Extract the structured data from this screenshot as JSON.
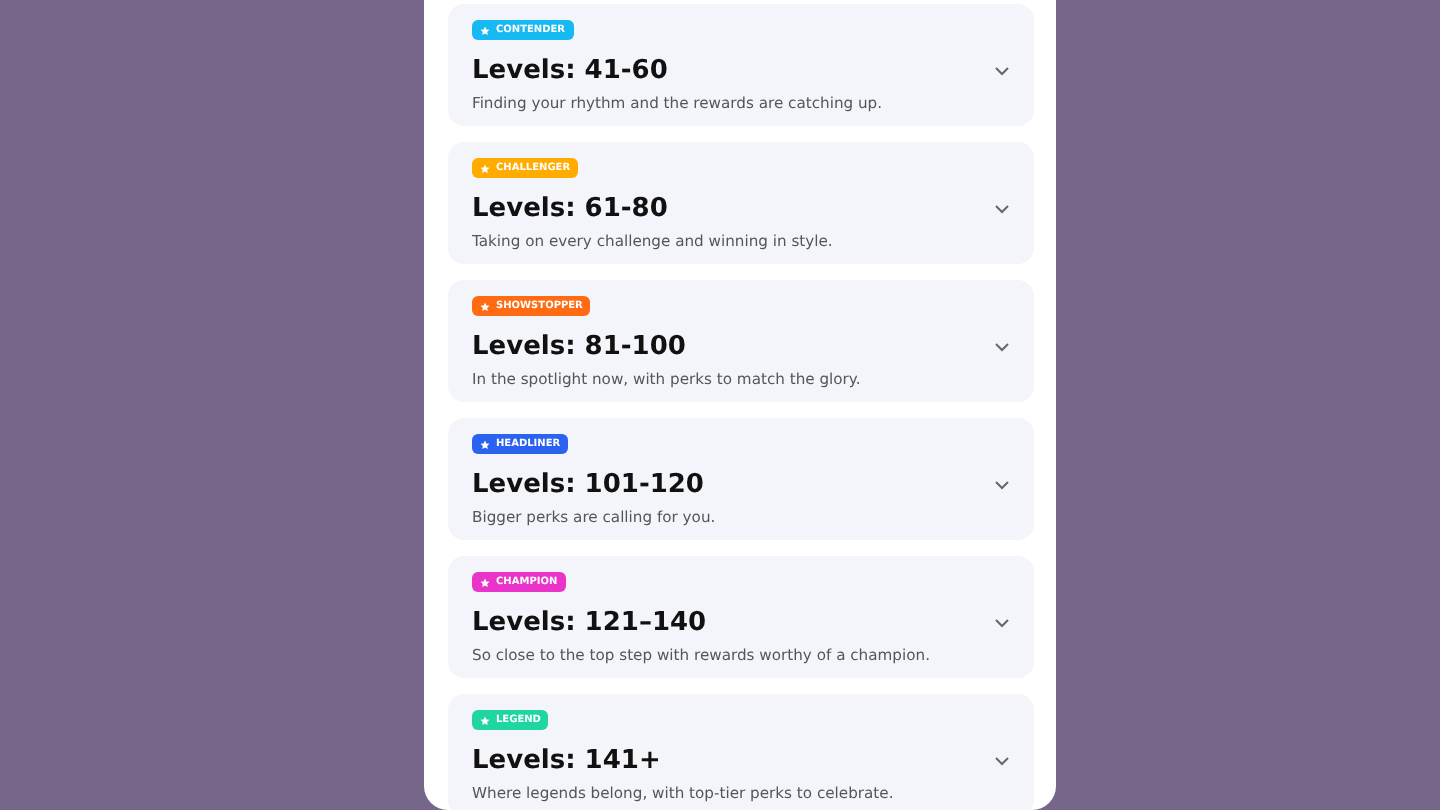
{
  "tiers": [
    {
      "badge": "CONTENDER",
      "color": "#17b9f2",
      "title": "Levels: 41-60",
      "description": "Finding your rhythm and the rewards are catching up.",
      "expanded": false
    },
    {
      "badge": "CHALLENGER",
      "color": "#ffab00",
      "title": "Levels: 61-80",
      "description": "Taking on every challenge and winning in style.",
      "expanded": false
    },
    {
      "badge": "SHOWSTOPPER",
      "color": "#ff6b12",
      "title": "Levels: 81-100",
      "description": "In the spotlight now, with perks to match the glory.",
      "expanded": false
    },
    {
      "badge": "HEADLINER",
      "color": "#2b62f0",
      "title": "Levels: 101-120",
      "description": "Bigger perks are calling for you.",
      "expanded": false
    },
    {
      "badge": "CHAMPION",
      "color": "#ea33c9",
      "title": "Levels: 121–140",
      "description": "So close to the top step with rewards worthy of a champion.",
      "expanded": false
    },
    {
      "badge": "LEGEND",
      "color": "#1fd6a2",
      "title": "Levels: 141+",
      "description": "Where legends belong, with top-tier perks to celebrate.",
      "expanded": false
    }
  ]
}
